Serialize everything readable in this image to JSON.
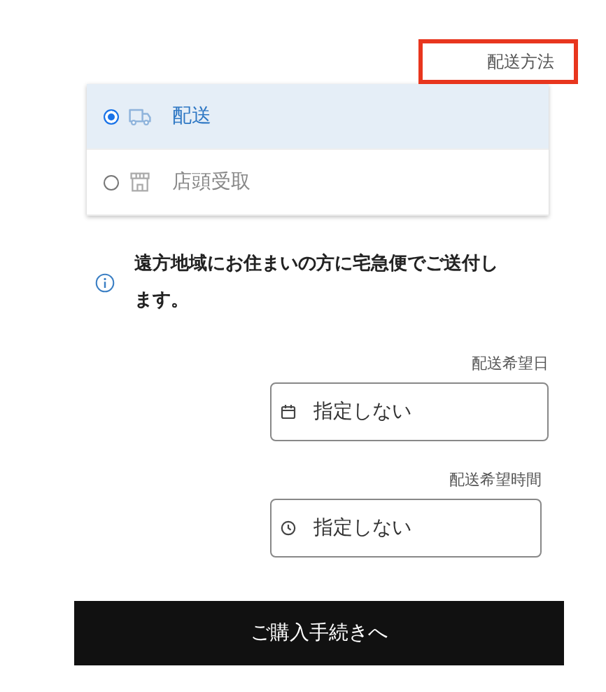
{
  "section_title": "配送方法",
  "delivery_options": [
    {
      "label": "配送",
      "kind": "truck",
      "selected": true
    },
    {
      "label": "店頭受取",
      "kind": "store",
      "selected": false
    }
  ],
  "notice": "遠方地域にお住まいの方に宅急便でご送付します。",
  "fields": [
    {
      "label": "配送希望日",
      "value": "指定しない",
      "kind": "date"
    },
    {
      "label": "配送希望時間",
      "value": "指定しない",
      "kind": "time"
    }
  ],
  "checkout_button": "ご購入手続きへ"
}
